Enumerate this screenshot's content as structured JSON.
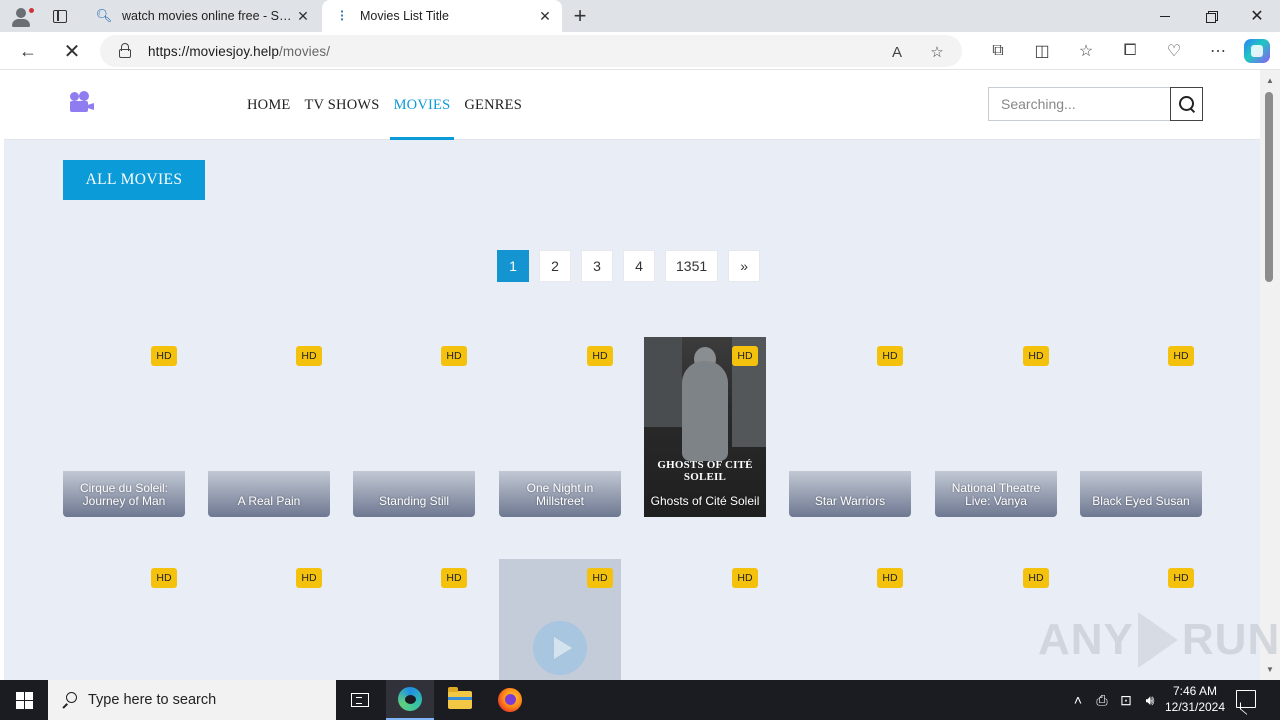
{
  "browser": {
    "tabs": [
      {
        "title": "watch movies online free - Search",
        "icon": "bing-search-icon",
        "active": false
      },
      {
        "title": "Movies List Title",
        "icon": "loading-icon",
        "active": true
      }
    ],
    "new_tab_label": "+",
    "url_host": "https://moviesjoy.help",
    "url_path": "/movies/",
    "read_aloud_glyph": "A",
    "window_controls": [
      "minimize",
      "restore",
      "close"
    ]
  },
  "site": {
    "logo_icon": "movie-camera-icon",
    "menu": [
      {
        "label": "HOME",
        "active": false
      },
      {
        "label": "TV SHOWS",
        "active": false
      },
      {
        "label": "MOVIES",
        "active": true
      },
      {
        "label": "GENRES",
        "active": false
      }
    ],
    "search_placeholder": "Searching...",
    "accent_color": "#0b9bd8",
    "all_movies_label": "ALL MOVIES",
    "pagination": [
      "1",
      "2",
      "3",
      "4",
      "1351",
      "»"
    ],
    "current_page": "1",
    "badge_label": "HD",
    "movies_row1": [
      {
        "title": "Cirque du Soleil: Journey of Man"
      },
      {
        "title": "A Real Pain"
      },
      {
        "title": "Standing Still"
      },
      {
        "title": "One Night in Millstreet"
      },
      {
        "title": "Ghosts of Cité Soleil",
        "poster_text": "GHOSTS OF CITÉ SOLEIL"
      },
      {
        "title": "Star Warriors"
      },
      {
        "title": "National Theatre Live: Vanya"
      },
      {
        "title": "Black Eyed Susan"
      }
    ],
    "movies_row2_badge_count": 8
  },
  "watermark": "ANY RUN",
  "taskbar": {
    "search_placeholder": "Type here to search",
    "time": "7:46 AM",
    "date": "12/31/2024"
  }
}
